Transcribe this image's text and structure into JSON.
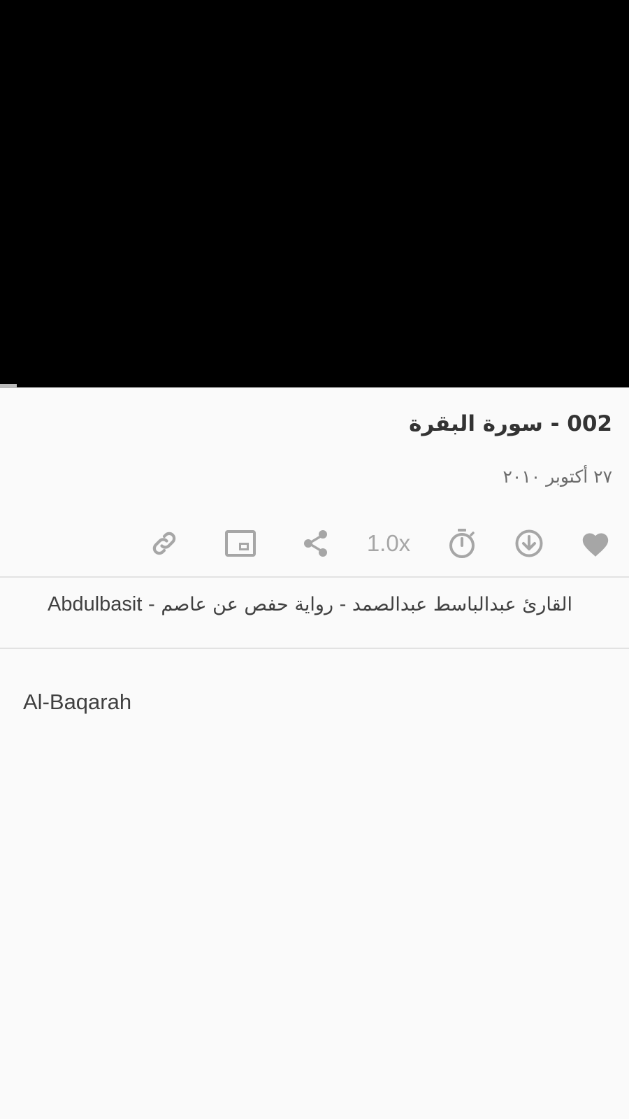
{
  "player": {
    "progress_fraction": 0.0
  },
  "episode": {
    "title": "002 - سورة البقرة",
    "date": "٢٧ أكتوبر ٢٠١٠"
  },
  "actions": {
    "speed_label": "1.0x",
    "icons": [
      "favorite-icon",
      "download-icon",
      "sleep-timer-icon",
      "speed-control",
      "share-icon",
      "picture-in-picture-icon",
      "copy-link-icon"
    ],
    "icon_color": "#a6a6a6"
  },
  "reciter": {
    "english": "Abdulbasit",
    "separator": " - ",
    "arabic": "القارئ عبدالباسط عبدالصمد - رواية حفص عن عاصم"
  },
  "description": {
    "text": "Al-Baqarah"
  }
}
